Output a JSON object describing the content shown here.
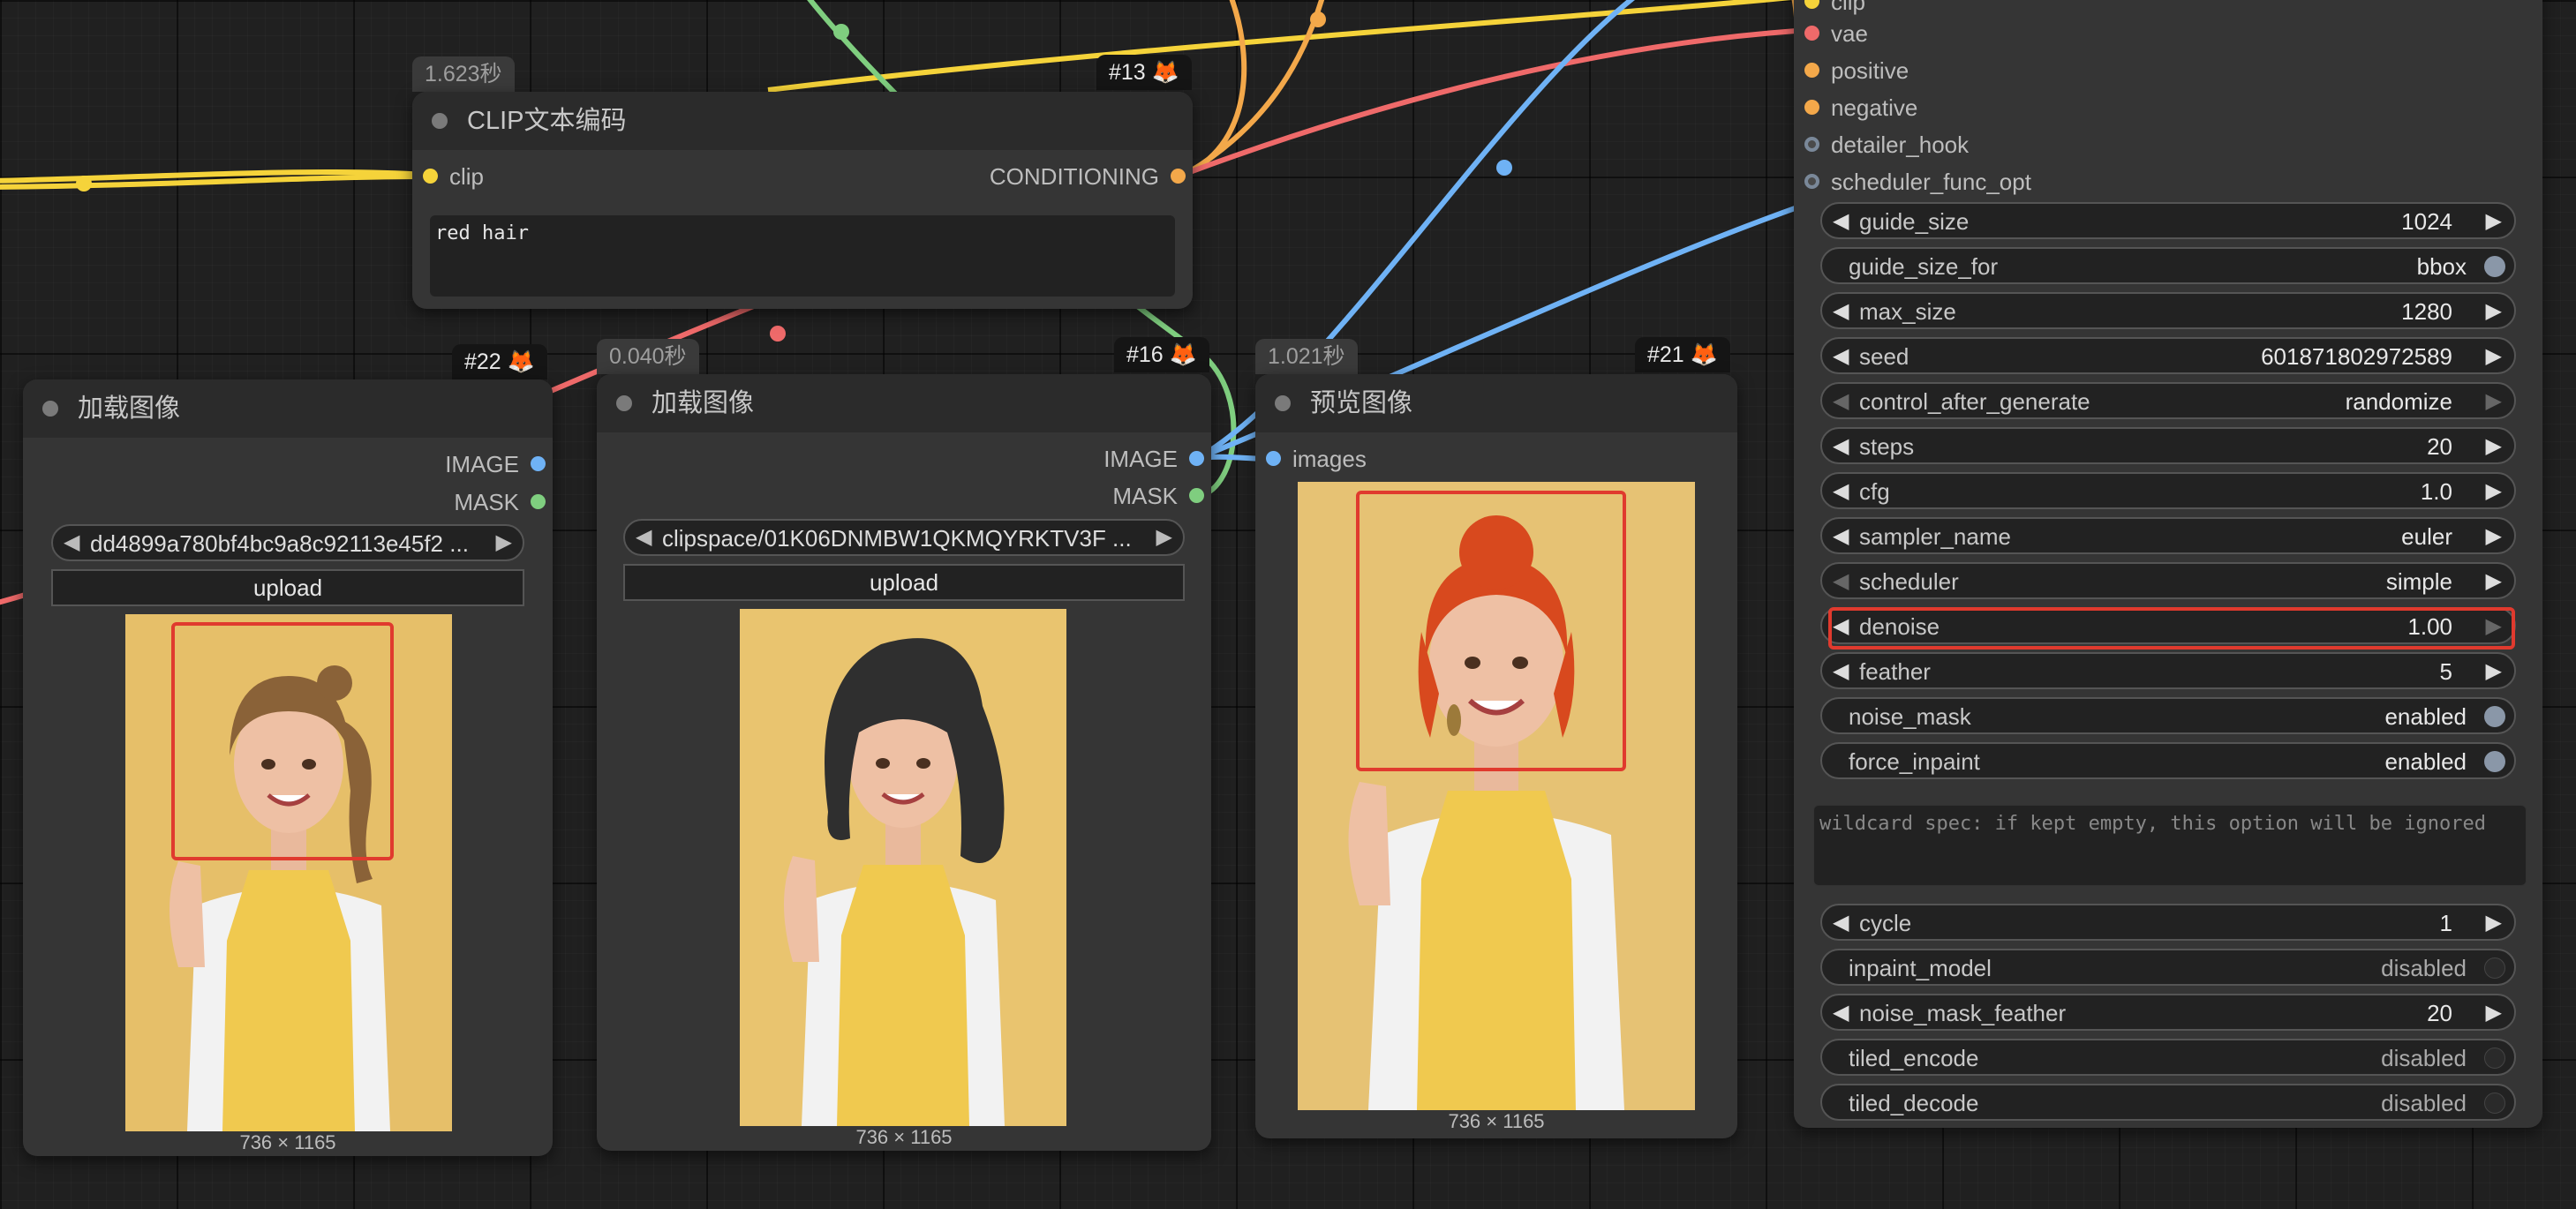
{
  "nodes": {
    "clip_text": {
      "title": "CLIP文本编码",
      "time": "1.623秒",
      "id": "#13 🦊",
      "input": "clip",
      "output": "CONDITIONING",
      "text": "red hair"
    },
    "load_image_1": {
      "title": "加载图像",
      "id": "#22 🦊",
      "outputs": [
        "IMAGE",
        "MASK"
      ],
      "file": "dd4899a780bf4bc9a8c92113e45f2 ...",
      "upload": "upload",
      "dims": "736 × 1165"
    },
    "load_image_2": {
      "title": "加载图像",
      "time": "0.040秒",
      "id": "#16 🦊",
      "outputs": [
        "IMAGE",
        "MASK"
      ],
      "file": "clipspace/01K06DNMBW1QKMQYRKTV3F ...",
      "upload": "upload",
      "dims": "736 × 1165"
    },
    "preview": {
      "title": "预览图像",
      "time": "1.021秒",
      "id": "#21 🦊",
      "input": "images",
      "dims": "736 × 1165"
    },
    "detailer": {
      "inputs": [
        "clip",
        "vae",
        "positive",
        "negative",
        "detailer_hook",
        "scheduler_func_opt"
      ],
      "widgets": [
        {
          "name": "guide_size",
          "value": "1024",
          "kind": "number"
        },
        {
          "name": "guide_size_for",
          "value": "bbox",
          "kind": "toggle",
          "on": true
        },
        {
          "name": "max_size",
          "value": "1280",
          "kind": "number"
        },
        {
          "name": "seed",
          "value": "601871802972589",
          "kind": "number"
        },
        {
          "name": "control_after_generate",
          "value": "randomize",
          "kind": "combo"
        },
        {
          "name": "steps",
          "value": "20",
          "kind": "number"
        },
        {
          "name": "cfg",
          "value": "1.0",
          "kind": "number"
        },
        {
          "name": "sampler_name",
          "value": "euler",
          "kind": "combo"
        },
        {
          "name": "scheduler",
          "value": "simple",
          "kind": "combo"
        },
        {
          "name": "denoise",
          "value": "1.00",
          "kind": "number"
        },
        {
          "name": "feather",
          "value": "5",
          "kind": "number"
        },
        {
          "name": "noise_mask",
          "value": "enabled",
          "kind": "toggle",
          "on": true
        },
        {
          "name": "force_inpaint",
          "value": "enabled",
          "kind": "toggle",
          "on": true
        }
      ],
      "wildcard_placeholder": "wildcard spec: if kept empty, this option will be ignored",
      "widgets2": [
        {
          "name": "cycle",
          "value": "1",
          "kind": "number"
        },
        {
          "name": "inpaint_model",
          "value": "disabled",
          "kind": "toggle",
          "on": false
        },
        {
          "name": "noise_mask_feather",
          "value": "20",
          "kind": "number"
        },
        {
          "name": "tiled_encode",
          "value": "disabled",
          "kind": "toggle",
          "on": false
        },
        {
          "name": "tiled_decode",
          "value": "disabled",
          "kind": "toggle",
          "on": false
        }
      ]
    }
  },
  "colors": {
    "clip": "#f5d33a",
    "conditioning": "#f3a84a",
    "vae": "#ef6a6a",
    "image": "#6fb2f5",
    "mask": "#7fce7f",
    "optional": "#7a8899",
    "highlight": "#e03a2e"
  },
  "icons": {
    "node_dot": "circle-icon",
    "arrow_left": "◀",
    "arrow_right": "▶"
  }
}
